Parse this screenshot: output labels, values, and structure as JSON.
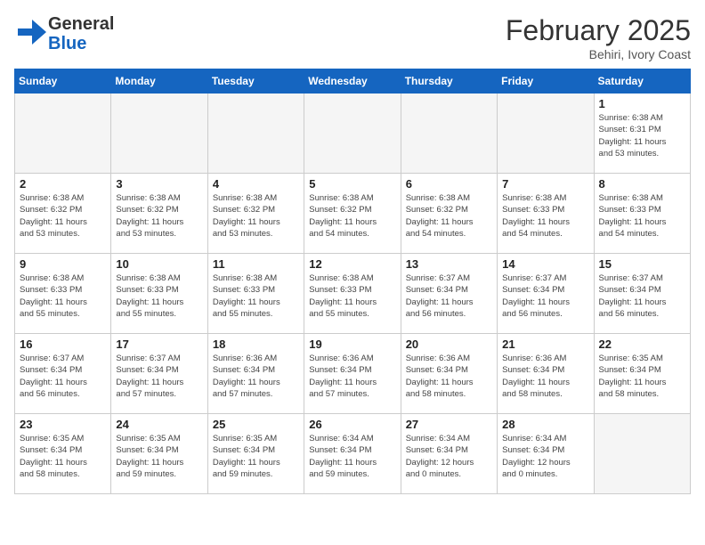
{
  "header": {
    "logo_general": "General",
    "logo_blue": "Blue",
    "month_title": "February 2025",
    "location": "Behiri, Ivory Coast"
  },
  "weekdays": [
    "Sunday",
    "Monday",
    "Tuesday",
    "Wednesday",
    "Thursday",
    "Friday",
    "Saturday"
  ],
  "weeks": [
    [
      {
        "day": "",
        "info": ""
      },
      {
        "day": "",
        "info": ""
      },
      {
        "day": "",
        "info": ""
      },
      {
        "day": "",
        "info": ""
      },
      {
        "day": "",
        "info": ""
      },
      {
        "day": "",
        "info": ""
      },
      {
        "day": "1",
        "info": "Sunrise: 6:38 AM\nSunset: 6:31 PM\nDaylight: 11 hours\nand 53 minutes."
      }
    ],
    [
      {
        "day": "2",
        "info": "Sunrise: 6:38 AM\nSunset: 6:32 PM\nDaylight: 11 hours\nand 53 minutes."
      },
      {
        "day": "3",
        "info": "Sunrise: 6:38 AM\nSunset: 6:32 PM\nDaylight: 11 hours\nand 53 minutes."
      },
      {
        "day": "4",
        "info": "Sunrise: 6:38 AM\nSunset: 6:32 PM\nDaylight: 11 hours\nand 53 minutes."
      },
      {
        "day": "5",
        "info": "Sunrise: 6:38 AM\nSunset: 6:32 PM\nDaylight: 11 hours\nand 54 minutes."
      },
      {
        "day": "6",
        "info": "Sunrise: 6:38 AM\nSunset: 6:32 PM\nDaylight: 11 hours\nand 54 minutes."
      },
      {
        "day": "7",
        "info": "Sunrise: 6:38 AM\nSunset: 6:33 PM\nDaylight: 11 hours\nand 54 minutes."
      },
      {
        "day": "8",
        "info": "Sunrise: 6:38 AM\nSunset: 6:33 PM\nDaylight: 11 hours\nand 54 minutes."
      }
    ],
    [
      {
        "day": "9",
        "info": "Sunrise: 6:38 AM\nSunset: 6:33 PM\nDaylight: 11 hours\nand 55 minutes."
      },
      {
        "day": "10",
        "info": "Sunrise: 6:38 AM\nSunset: 6:33 PM\nDaylight: 11 hours\nand 55 minutes."
      },
      {
        "day": "11",
        "info": "Sunrise: 6:38 AM\nSunset: 6:33 PM\nDaylight: 11 hours\nand 55 minutes."
      },
      {
        "day": "12",
        "info": "Sunrise: 6:38 AM\nSunset: 6:33 PM\nDaylight: 11 hours\nand 55 minutes."
      },
      {
        "day": "13",
        "info": "Sunrise: 6:37 AM\nSunset: 6:34 PM\nDaylight: 11 hours\nand 56 minutes."
      },
      {
        "day": "14",
        "info": "Sunrise: 6:37 AM\nSunset: 6:34 PM\nDaylight: 11 hours\nand 56 minutes."
      },
      {
        "day": "15",
        "info": "Sunrise: 6:37 AM\nSunset: 6:34 PM\nDaylight: 11 hours\nand 56 minutes."
      }
    ],
    [
      {
        "day": "16",
        "info": "Sunrise: 6:37 AM\nSunset: 6:34 PM\nDaylight: 11 hours\nand 56 minutes."
      },
      {
        "day": "17",
        "info": "Sunrise: 6:37 AM\nSunset: 6:34 PM\nDaylight: 11 hours\nand 57 minutes."
      },
      {
        "day": "18",
        "info": "Sunrise: 6:36 AM\nSunset: 6:34 PM\nDaylight: 11 hours\nand 57 minutes."
      },
      {
        "day": "19",
        "info": "Sunrise: 6:36 AM\nSunset: 6:34 PM\nDaylight: 11 hours\nand 57 minutes."
      },
      {
        "day": "20",
        "info": "Sunrise: 6:36 AM\nSunset: 6:34 PM\nDaylight: 11 hours\nand 58 minutes."
      },
      {
        "day": "21",
        "info": "Sunrise: 6:36 AM\nSunset: 6:34 PM\nDaylight: 11 hours\nand 58 minutes."
      },
      {
        "day": "22",
        "info": "Sunrise: 6:35 AM\nSunset: 6:34 PM\nDaylight: 11 hours\nand 58 minutes."
      }
    ],
    [
      {
        "day": "23",
        "info": "Sunrise: 6:35 AM\nSunset: 6:34 PM\nDaylight: 11 hours\nand 58 minutes."
      },
      {
        "day": "24",
        "info": "Sunrise: 6:35 AM\nSunset: 6:34 PM\nDaylight: 11 hours\nand 59 minutes."
      },
      {
        "day": "25",
        "info": "Sunrise: 6:35 AM\nSunset: 6:34 PM\nDaylight: 11 hours\nand 59 minutes."
      },
      {
        "day": "26",
        "info": "Sunrise: 6:34 AM\nSunset: 6:34 PM\nDaylight: 11 hours\nand 59 minutes."
      },
      {
        "day": "27",
        "info": "Sunrise: 6:34 AM\nSunset: 6:34 PM\nDaylight: 12 hours\nand 0 minutes."
      },
      {
        "day": "28",
        "info": "Sunrise: 6:34 AM\nSunset: 6:34 PM\nDaylight: 12 hours\nand 0 minutes."
      },
      {
        "day": "",
        "info": ""
      }
    ]
  ]
}
